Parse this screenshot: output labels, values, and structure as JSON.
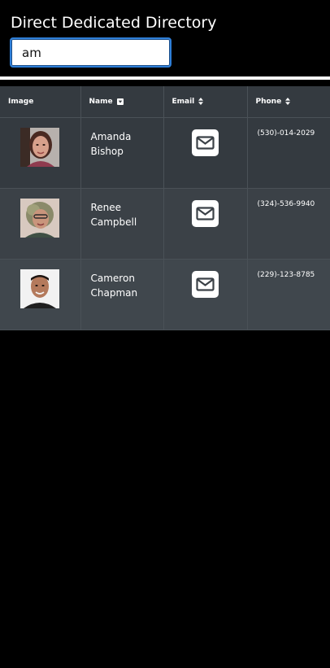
{
  "app": {
    "title": "Direct Dedicated Directory"
  },
  "search": {
    "value": "am",
    "placeholder": ""
  },
  "table": {
    "headers": {
      "image": "Image",
      "name": "Name",
      "email": "Email",
      "phone": "Phone"
    },
    "sort": {
      "name": "sort-down-icon",
      "email": "sort-both-icon",
      "phone": "sort-both-icon"
    },
    "rows": [
      {
        "first": "Amanda",
        "last": "Bishop",
        "phone": "(530)-014-2029",
        "email_icon": "envelope-icon"
      },
      {
        "first": "Renee",
        "last": "Campbell",
        "phone": "(324)-536-9940",
        "email_icon": "envelope-icon"
      },
      {
        "first": "Cameron",
        "last": "Chapman",
        "phone": "(229)-123-8785",
        "email_icon": "envelope-icon"
      }
    ]
  },
  "colors": {
    "background": "#000000",
    "table_header": "#343a40",
    "row_dark": "#343a40",
    "row_mid": "#3b4147",
    "row_light": "#40474d",
    "input_focus": "#2f7fd8"
  }
}
